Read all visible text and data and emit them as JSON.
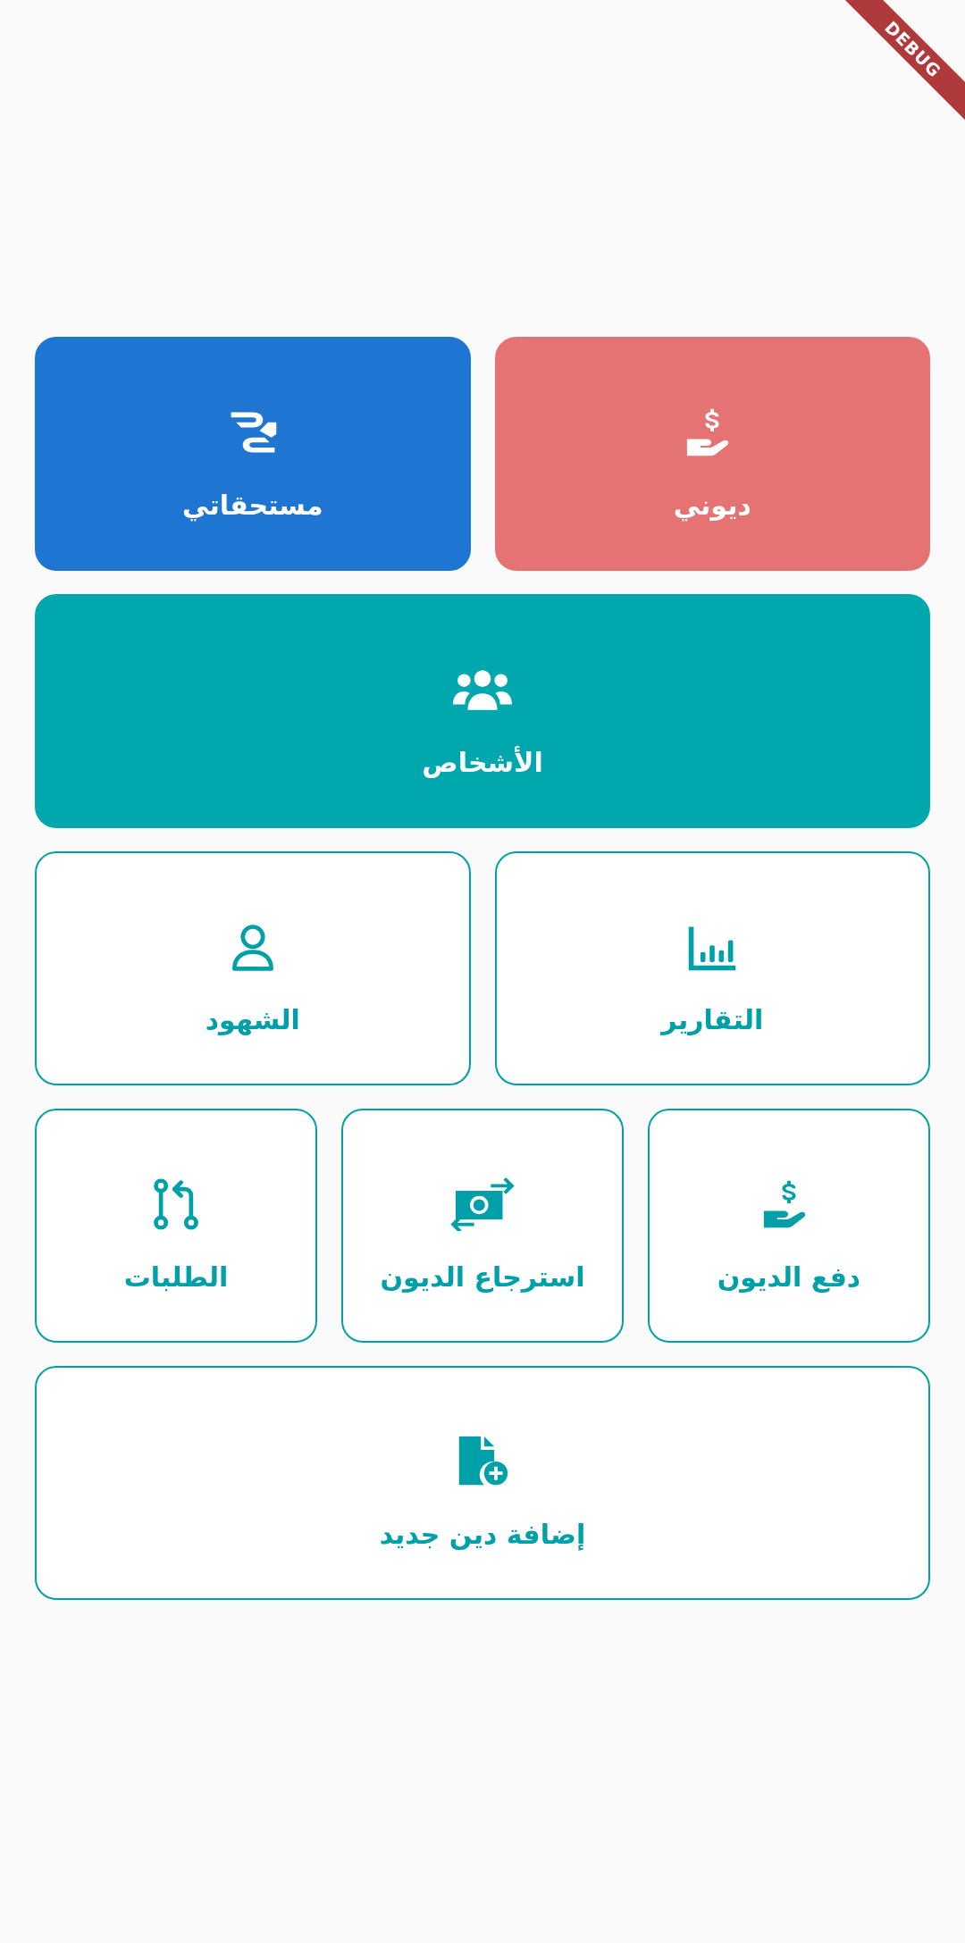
{
  "debug_banner": {
    "label": "DEBUG"
  },
  "rows": [
    [
      {
        "label": "ديوني",
        "kind": "filled",
        "color": "#e57373"
      },
      {
        "label": "مستحقاتي",
        "kind": "filled",
        "color": "#1e76d2"
      }
    ],
    [
      {
        "label": "الأشخاص",
        "kind": "filled",
        "color": "#00a8ae"
      }
    ],
    [
      {
        "label": "التقارير",
        "kind": "outlined",
        "color": "#00a0a8"
      },
      {
        "label": "الشهود",
        "kind": "outlined",
        "color": "#00a0a8"
      }
    ],
    [
      {
        "label": "دفع الديون",
        "kind": "outlined",
        "color": "#00a0a8"
      },
      {
        "label": "استرجاع الديون",
        "kind": "outlined",
        "color": "#00a0a8"
      },
      {
        "label": "الطلبات",
        "kind": "outlined",
        "color": "#00a0a8"
      }
    ],
    [
      {
        "label": "إضافة دين جديد",
        "kind": "outlined",
        "color": "#00a0a8"
      }
    ]
  ]
}
